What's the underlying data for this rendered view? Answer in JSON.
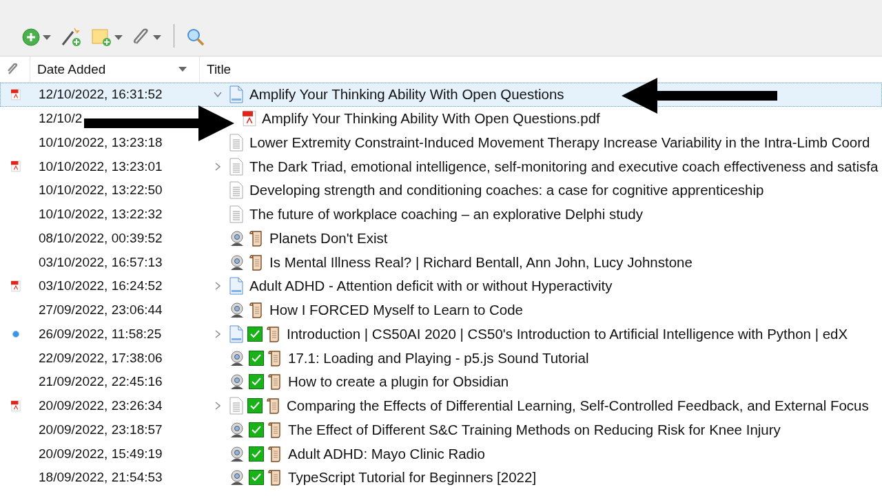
{
  "columns": [
    {
      "label": "Date Added",
      "sorted": true
    },
    {
      "label": "Title",
      "sorted": false
    }
  ],
  "rows": [
    {
      "date": "12/10/2022, 16:31:52",
      "pdf_attached": true,
      "dot": false,
      "expanded": true,
      "kind": "document",
      "done": false,
      "snapshot": false,
      "selected": true,
      "title": "Amplify Your Thinking Ability With Open Questions",
      "children": [
        {
          "date": "12/10/2",
          "pdf_attached": false,
          "dot": false,
          "kind": "pdf",
          "done": false,
          "snapshot": false,
          "selected": false,
          "title": "Amplify Your Thinking Ability With Open Questions.pdf"
        }
      ]
    },
    {
      "date": "10/10/2022, 13:23:18",
      "pdf_attached": false,
      "dot": false,
      "kind": "note",
      "done": false,
      "snapshot": false,
      "selected": false,
      "title": "Lower Extremity Constraint-Induced Movement Therapy Increase Variability in the Intra-Limb Coord"
    },
    {
      "date": "10/10/2022, 13:23:01",
      "pdf_attached": true,
      "dot": false,
      "expanded": false,
      "kind": "note",
      "done": false,
      "snapshot": false,
      "selected": false,
      "title": "The Dark Triad, emotional intelligence, self-monitoring and executive coach effectiveness and satisfa"
    },
    {
      "date": "10/10/2022, 13:22:50",
      "pdf_attached": false,
      "dot": false,
      "kind": "note",
      "done": false,
      "snapshot": false,
      "selected": false,
      "title": "Developing strength and conditioning coaches: a case for cognitive apprenticeship"
    },
    {
      "date": "10/10/2022, 13:22:32",
      "pdf_attached": false,
      "dot": false,
      "kind": "note",
      "done": false,
      "snapshot": false,
      "selected": false,
      "title": "The future of workplace coaching – an explorative Delphi study"
    },
    {
      "date": "08/10/2022, 00:39:52",
      "pdf_attached": false,
      "dot": false,
      "kind": "video",
      "done": false,
      "snapshot": true,
      "selected": false,
      "title": "Planets Don't Exist"
    },
    {
      "date": "03/10/2022, 16:57:13",
      "pdf_attached": false,
      "dot": false,
      "kind": "video",
      "done": false,
      "snapshot": true,
      "selected": false,
      "title": "Is Mental Illness Real? | Richard Bentall, Ann John, Lucy Johnstone"
    },
    {
      "date": "03/10/2022, 16:24:52",
      "pdf_attached": true,
      "dot": false,
      "expanded": false,
      "kind": "document",
      "done": false,
      "snapshot": false,
      "selected": false,
      "title": "Adult ADHD - Attention deficit with or without Hyperactivity"
    },
    {
      "date": "27/09/2022, 23:06:44",
      "pdf_attached": false,
      "dot": false,
      "kind": "video",
      "done": false,
      "snapshot": true,
      "selected": false,
      "title": "How I FORCED Myself to Learn to Code"
    },
    {
      "date": "26/09/2022, 11:58:25",
      "pdf_attached": false,
      "dot": true,
      "expanded": false,
      "kind": "document",
      "done": true,
      "snapshot": true,
      "selected": false,
      "title": "Introduction | CS50AI 2020 | CS50's Introduction to Artificial Intelligence with Python | edX"
    },
    {
      "date": "22/09/2022, 17:38:06",
      "pdf_attached": false,
      "dot": false,
      "kind": "video",
      "done": true,
      "snapshot": true,
      "selected": false,
      "title": "17.1: Loading and Playing - p5.js Sound Tutorial"
    },
    {
      "date": "21/09/2022, 22:45:16",
      "pdf_attached": false,
      "dot": false,
      "kind": "video",
      "done": true,
      "snapshot": true,
      "selected": false,
      "title": "How to create a plugin for Obsidian"
    },
    {
      "date": "20/09/2022, 23:26:34",
      "pdf_attached": true,
      "dot": false,
      "expanded": false,
      "kind": "note",
      "done": true,
      "snapshot": true,
      "selected": false,
      "title": "Comparing the Effects of Differential Learning, Self-Controlled Feedback, and External Focus"
    },
    {
      "date": "20/09/2022, 23:18:57",
      "pdf_attached": false,
      "dot": false,
      "kind": "video",
      "done": true,
      "snapshot": true,
      "selected": false,
      "title": "The Effect of Different S&C Training Methods on Reducing Risk for Knee Injury"
    },
    {
      "date": "20/09/2022, 15:49:19",
      "pdf_attached": false,
      "dot": false,
      "kind": "video",
      "done": true,
      "snapshot": true,
      "selected": false,
      "title": "Adult ADHD: Mayo Clinic Radio"
    },
    {
      "date": "18/09/2022, 21:54:53",
      "pdf_attached": false,
      "dot": false,
      "kind": "video",
      "done": true,
      "snapshot": true,
      "selected": false,
      "title": "TypeScript Tutorial for Beginners [2022]"
    }
  ]
}
